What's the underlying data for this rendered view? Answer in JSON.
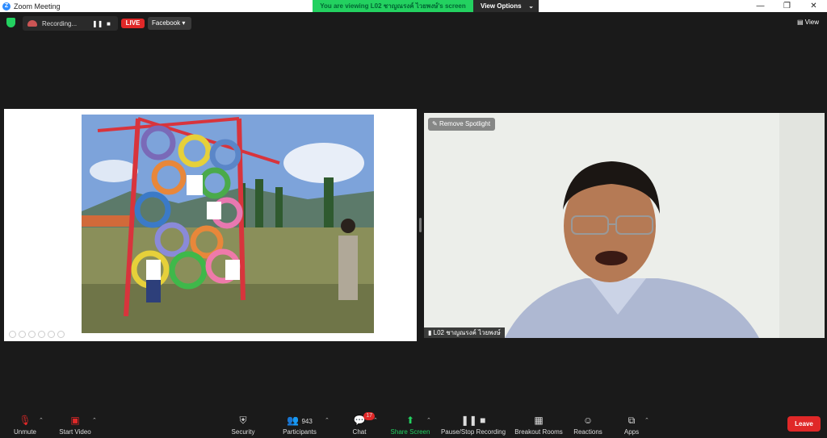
{
  "window": {
    "title": "Zoom Meeting",
    "controls": [
      "—",
      "❐",
      "✕"
    ]
  },
  "banner": {
    "viewing_text": "You are viewing L02 ชาญณรงค์ ไวยพงษ์'s screen",
    "view_options_label": "View Options",
    "chevron": "⌄"
  },
  "status": {
    "recording_label": "Recording...",
    "pause_glyph": "❚❚",
    "stop_glyph": "■",
    "live_label": "LIVE",
    "facebook_label": "Facebook ▾",
    "view_label": "View"
  },
  "share": {
    "controls": [
      "c1",
      "c2",
      "c3",
      "c4",
      "c5",
      "c6"
    ]
  },
  "speaker": {
    "spotlight_label": "Remove Spotlight",
    "name_label": "L02 ชาญณรงค์ ไวยพงษ์"
  },
  "toolbar": {
    "unmute": "Unmute",
    "start_video": "Start Video",
    "security": "Security",
    "participants": "Participants",
    "participants_count": "943",
    "chat": "Chat",
    "chat_badge": "17",
    "share_screen": "Share Screen",
    "pause_stop_recording": "Pause/Stop Recording",
    "breakout_rooms": "Breakout Rooms",
    "reactions": "Reactions",
    "apps": "Apps",
    "leave": "Leave"
  },
  "colors": {
    "accent_green": "#23d160",
    "live_red": "#e02828",
    "zoom_blue": "#2d8cff"
  }
}
